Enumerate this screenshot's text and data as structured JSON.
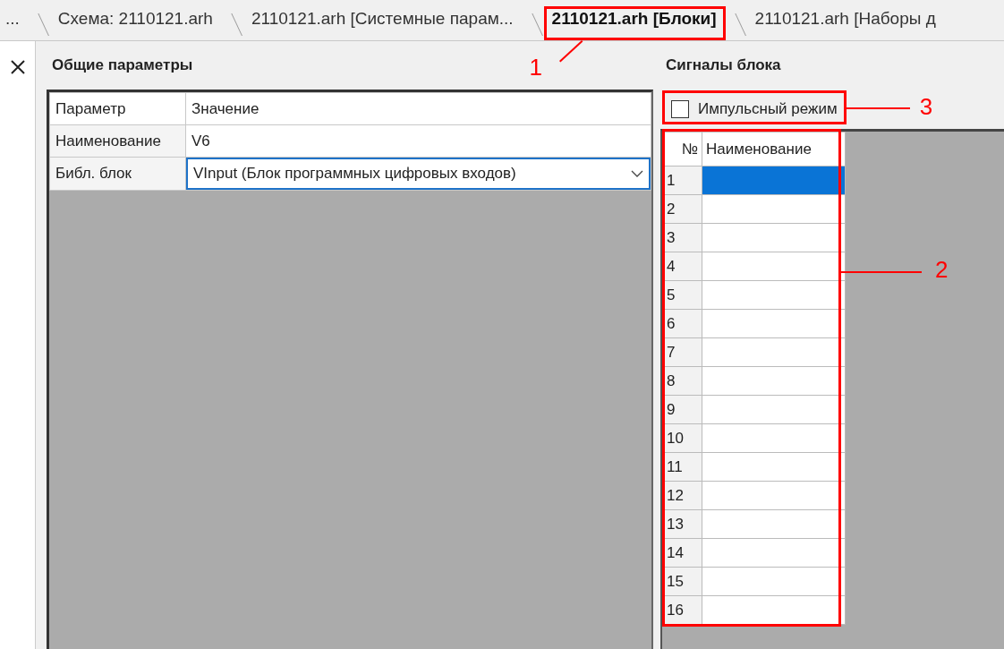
{
  "tabs": [
    {
      "label": "...",
      "selected": false
    },
    {
      "label": "Схема: 2110121.arh",
      "selected": false
    },
    {
      "label": "2110121.arh [Системные парам...",
      "selected": false
    },
    {
      "label": "2110121.arh [Блоки]",
      "selected": true
    },
    {
      "label": "2110121.arh [Наборы д",
      "selected": false
    }
  ],
  "general": {
    "title": "Общие параметры",
    "columns": [
      "Параметр",
      "Значение"
    ],
    "rows": [
      {
        "kind": "text",
        "label": "Наименование",
        "value": "V6"
      },
      {
        "kind": "dropdown",
        "label": "Библ. блок",
        "value": "VInput (Блок программных цифровых входов)"
      }
    ]
  },
  "signals": {
    "title": "Сигналы блока",
    "pulse_mode": {
      "label": "Импульсный режим",
      "checked": false
    },
    "columns": [
      "№",
      "Наименование"
    ],
    "rows": [
      {
        "number": "1",
        "selected": true
      },
      {
        "number": "2",
        "selected": false
      },
      {
        "number": "3",
        "selected": false
      },
      {
        "number": "4",
        "selected": false
      },
      {
        "number": "5",
        "selected": false
      },
      {
        "number": "6",
        "selected": false
      },
      {
        "number": "7",
        "selected": false
      },
      {
        "number": "8",
        "selected": false
      },
      {
        "number": "9",
        "selected": false
      },
      {
        "number": "10",
        "selected": false
      },
      {
        "number": "11",
        "selected": false
      },
      {
        "number": "12",
        "selected": false
      },
      {
        "number": "13",
        "selected": false
      },
      {
        "number": "14",
        "selected": false
      },
      {
        "number": "15",
        "selected": false
      },
      {
        "number": "16",
        "selected": false
      }
    ]
  },
  "callouts": [
    {
      "label": "1"
    },
    {
      "label": "2"
    },
    {
      "label": "3"
    }
  ]
}
